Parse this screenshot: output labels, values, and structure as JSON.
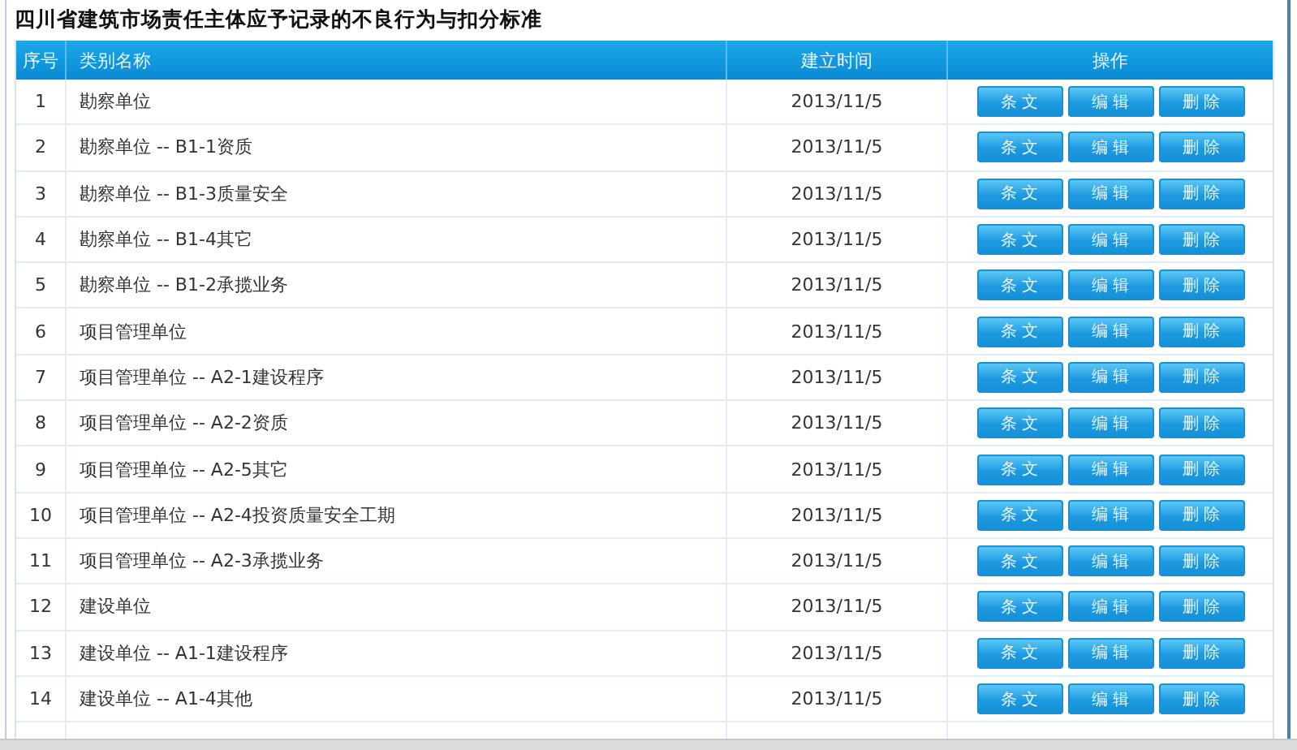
{
  "title": "四川省建筑市场责任主体应予记录的不良行为与扣分标准",
  "table": {
    "columns": [
      "序号",
      "类别名称",
      "建立时间",
      "操作"
    ],
    "rows": [
      {
        "index": "1",
        "name": "勘察单位",
        "created": "2013/11/5",
        "actions": [
          "条 文",
          "编 辑",
          "删 除"
        ]
      },
      {
        "index": "2",
        "name": "勘察单位 -- B1-1资质",
        "created": "2013/11/5",
        "actions": [
          "条 文",
          "编 辑",
          "删 除"
        ]
      },
      {
        "index": "3",
        "name": "勘察单位 -- B1-3质量安全",
        "created": "2013/11/5",
        "actions": [
          "条 文",
          "编 辑",
          "删 除"
        ]
      },
      {
        "index": "4",
        "name": "勘察单位 -- B1-4其它",
        "created": "2013/11/5",
        "actions": [
          "条 文",
          "编 辑",
          "删 除"
        ]
      },
      {
        "index": "5",
        "name": "勘察单位 -- B1-2承揽业务",
        "created": "2013/11/5",
        "actions": [
          "条 文",
          "编 辑",
          "删 除"
        ]
      },
      {
        "index": "6",
        "name": "项目管理单位",
        "created": "2013/11/5",
        "actions": [
          "条 文",
          "编 辑",
          "删 除"
        ]
      },
      {
        "index": "7",
        "name": "项目管理单位 -- A2-1建设程序",
        "created": "2013/11/5",
        "actions": [
          "条 文",
          "编 辑",
          "删 除"
        ]
      },
      {
        "index": "8",
        "name": "项目管理单位 -- A2-2资质",
        "created": "2013/11/5",
        "actions": [
          "条 文",
          "编 辑",
          "删 除"
        ]
      },
      {
        "index": "9",
        "name": "项目管理单位 -- A2-5其它",
        "created": "2013/11/5",
        "actions": [
          "条 文",
          "编 辑",
          "删 除"
        ]
      },
      {
        "index": "10",
        "name": "项目管理单位 -- A2-4投资质量安全工期",
        "created": "2013/11/5",
        "actions": [
          "条 文",
          "编 辑",
          "删 除"
        ]
      },
      {
        "index": "11",
        "name": "项目管理单位 -- A2-3承揽业务",
        "created": "2013/11/5",
        "actions": [
          "条 文",
          "编 辑",
          "删 除"
        ]
      },
      {
        "index": "12",
        "name": "建设单位",
        "created": "2013/11/5",
        "actions": [
          "条 文",
          "编 辑",
          "删 除"
        ]
      },
      {
        "index": "13",
        "name": "建设单位 -- A1-1建设程序",
        "created": "2013/11/5",
        "actions": [
          "条 文",
          "编 辑",
          "删 除"
        ]
      },
      {
        "index": "14",
        "name": "建设单位 -- A1-4其他",
        "created": "2013/11/5",
        "actions": [
          "条 文",
          "编 辑",
          "删 除"
        ]
      }
    ]
  }
}
